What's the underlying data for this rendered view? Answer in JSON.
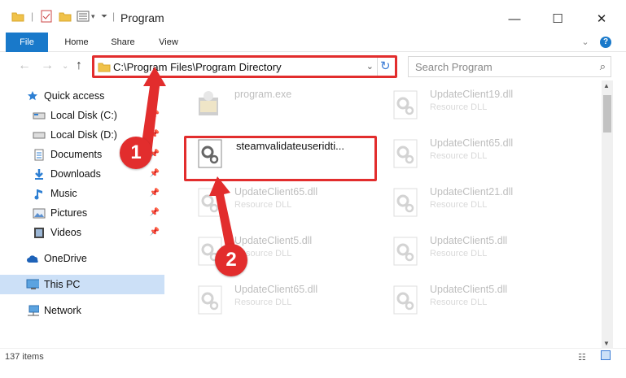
{
  "window": {
    "title": "Program",
    "minimize_glyph": "—",
    "maximize_glyph": "☐",
    "close_glyph": "✕"
  },
  "ribbon": {
    "tabs": [
      "File",
      "Home",
      "Share",
      "View"
    ],
    "help_glyph": "?"
  },
  "address": {
    "path": "C:\\Program Files\\Program Directory",
    "search_placeholder": "Search Program"
  },
  "sidebar": {
    "items": [
      {
        "label": "Quick access",
        "icon": "star-icon"
      },
      {
        "label": "Local Disk (C:)",
        "icon": "drive-icon"
      },
      {
        "label": "Local Disk (D:)",
        "icon": "drive-icon"
      },
      {
        "label": "Documents",
        "icon": "documents-icon"
      },
      {
        "label": "Downloads",
        "icon": "download-icon"
      },
      {
        "label": "Music",
        "icon": "music-icon"
      },
      {
        "label": "Pictures",
        "icon": "pictures-icon"
      },
      {
        "label": "Videos",
        "icon": "videos-icon"
      },
      {
        "label": "OneDrive",
        "icon": "cloud-icon"
      },
      {
        "label": "This PC",
        "icon": "computer-icon"
      },
      {
        "label": "Network",
        "icon": "network-icon"
      }
    ]
  },
  "files": [
    {
      "name": "program.exe",
      "type": "",
      "icon": "exe-icon"
    },
    {
      "name": "UpdateClient19.dll",
      "type": "Resource DLL",
      "icon": "dll-icon"
    },
    {
      "name": "steamvalidateuseridti...",
      "type": "",
      "icon": "dll-icon"
    },
    {
      "name": "UpdateClient65.dll",
      "type": "Resource DLL",
      "icon": "dll-icon"
    },
    {
      "name": "UpdateClient65.dll",
      "type": "Resource DLL",
      "icon": "dll-icon"
    },
    {
      "name": "UpdateClient21.dll",
      "type": "Resource DLL",
      "icon": "dll-icon"
    },
    {
      "name": "UpdateClient5.dll",
      "type": "Resource DLL",
      "icon": "dll-icon"
    },
    {
      "name": "UpdateClient5.dll",
      "type": "Resource DLL",
      "icon": "dll-icon"
    },
    {
      "name": "UpdateClient65.dll",
      "type": "Resource DLL",
      "icon": "dll-icon"
    },
    {
      "name": "UpdateClient5.dll",
      "type": "Resource DLL",
      "icon": "dll-icon"
    }
  ],
  "status": {
    "count": "137 items"
  },
  "annotations": {
    "step1": "1",
    "step2": "2"
  },
  "colors": {
    "accent": "#1979ca",
    "highlight": "#e22d2d",
    "selected": "#cce0f7"
  }
}
